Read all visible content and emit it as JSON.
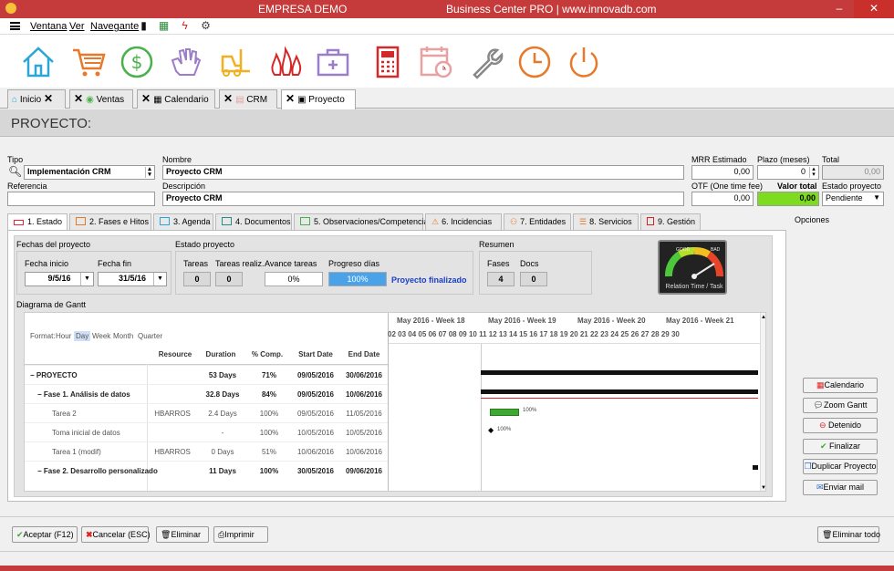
{
  "window": {
    "title": "EMPRESA DEMO",
    "subtitle": "Business Center PRO | www.innovadb.com",
    "min": "–",
    "max": "☐",
    "close": "✕"
  },
  "menu": {
    "items": [
      "Ventana",
      "Ver",
      "Navegante"
    ]
  },
  "doc_tabs": [
    {
      "label": "Inicio",
      "icon": "home-icon"
    },
    {
      "label": "Ventas",
      "icon": "coin-icon"
    },
    {
      "label": "Calendario",
      "icon": "calendar-icon"
    },
    {
      "label": "CRM",
      "icon": "crm-icon"
    },
    {
      "label": "Proyecto",
      "icon": "project-icon"
    }
  ],
  "page_title": "PROYECTO:",
  "form": {
    "tipo_label": "Tipo",
    "tipo_value": "Implementación CRM",
    "nombre_label": "Nombre",
    "nombre_value": "Proyecto CRM",
    "referencia_label": "Referencia",
    "referencia_value": "",
    "descripcion_label": "Descripción",
    "descripcion_value": "Proyecto CRM",
    "mrr_label": "MRR Estimado",
    "mrr_value": "0,00",
    "plazo_label": "Plazo (meses)",
    "plazo_value": "0",
    "total_label": "Total",
    "total_value": "0,00",
    "otf_label": "OTF (One time fee)",
    "otf_value": "0,00",
    "valor_total_label": "Valor total",
    "valor_total_value": "0,00",
    "estado_label": "Estado proyecto",
    "estado_value": "Pendiente"
  },
  "proj_tabs": [
    "1. Estado",
    "2. Fases e Hitos",
    "3. Agenda",
    "4. Documentos",
    "5. Observaciones/Competencia",
    "6. Incidencias",
    "7. Entidades",
    "8. Servicios",
    "9. Gestión"
  ],
  "opciones_label": "Opciones",
  "estado": {
    "fechas_label": "Fechas del proyecto",
    "fecha_inicio_label": "Fecha inicio",
    "fecha_inicio": "9/5/16",
    "fecha_fin_label": "Fecha fin",
    "fecha_fin": "31/5/16",
    "estado_proyecto_label": "Estado proyecto",
    "tareas_label": "Tareas",
    "tareas": "0",
    "tareas_realiz_label": "Tareas realiz.",
    "tareas_realiz": "0",
    "avance_label": "Avance tareas",
    "avance": "0%",
    "progreso_label": "Progreso días",
    "progreso": "100%",
    "progreso_fraction": 1.0,
    "finalizado": "Proyecto finalizado",
    "resumen_label": "Resumen",
    "fases_label": "Fases",
    "fases": "4",
    "docs_label": "Docs",
    "docs": "0",
    "gauge_caption": "Relation Time / Task",
    "gauge_good": "GOOD",
    "gauge_bad": "BAD"
  },
  "gantt": {
    "label": "Diagrama de Gantt",
    "format_label": "Format:",
    "formats": [
      "Hour",
      "Day",
      "Week",
      "Month",
      "Quarter"
    ],
    "format_selected": "Day",
    "columns": [
      "Resource",
      "Duration",
      "% Comp.",
      "Start Date",
      "End Date"
    ],
    "rows": [
      {
        "name": "− PROYECTO",
        "resource": "",
        "duration": "53 Days",
        "comp": "71%",
        "start": "09/05/2016",
        "end": "30/06/2016",
        "bold": true
      },
      {
        "name": "− Fase 1. Análisis de datos",
        "resource": "",
        "duration": "32.8 Days",
        "comp": "84%",
        "start": "09/05/2016",
        "end": "10/06/2016",
        "bold": true
      },
      {
        "name": "Tarea 2",
        "resource": "HBARROS",
        "duration": "2.4 Days",
        "comp": "100%",
        "start": "09/05/2016",
        "end": "11/05/2016",
        "bold": false
      },
      {
        "name": "Toma inicial de datos",
        "resource": "",
        "duration": "-",
        "comp": "100%",
        "start": "10/05/2016",
        "end": "10/05/2016",
        "bold": false
      },
      {
        "name": "Tarea 1 (modif)",
        "resource": "HBARROS",
        "duration": "0 Days",
        "comp": "51%",
        "start": "10/06/2016",
        "end": "10/06/2016",
        "bold": false
      },
      {
        "name": "− Fase 2. Desarrollo personalizado",
        "resource": "",
        "duration": "11 Days",
        "comp": "100%",
        "start": "30/05/2016",
        "end": "09/06/2016",
        "bold": true
      }
    ],
    "weeks": [
      "May 2016 - Week 18",
      "May 2016 - Week 19",
      "May 2016 - Week 20",
      "May 2016 - Week 21"
    ],
    "days": "02 03 04 05 06 07 08 09 10 11 12 13 14 15 16 17 18 19 20 21 22 23 24 25 26 27 28 29 30",
    "bar_label_1": "100%",
    "bar_label_2": "100%"
  },
  "side_buttons": [
    "Calendario",
    "Zoom Gantt",
    "Detenido",
    "Finalizar",
    "Duplicar Proyecto",
    "Enviar mail"
  ],
  "bottom_buttons": [
    "Aceptar (F12)",
    "Cancelar (ESC)",
    "Eliminar",
    "Imprimir"
  ],
  "eliminar_todo": "Eliminar todo"
}
